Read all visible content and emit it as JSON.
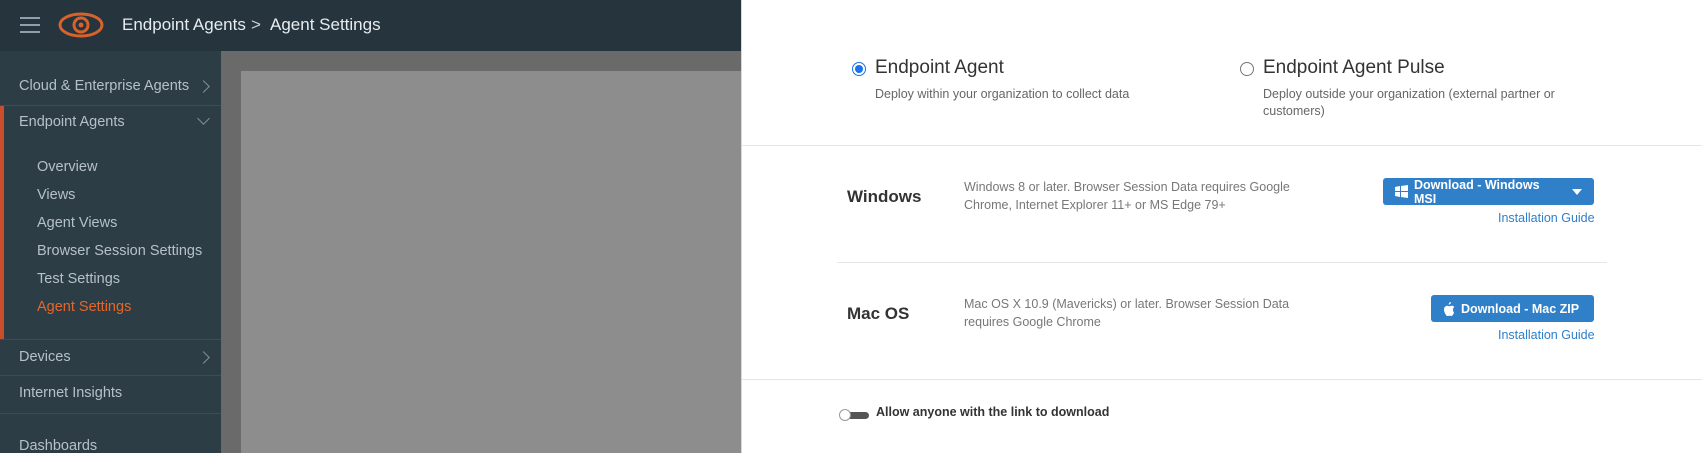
{
  "header": {
    "breadcrumb_1": "Endpoint Agents",
    "separator": ">",
    "breadcrumb_2": "Agent Settings"
  },
  "sidebar": {
    "items": [
      {
        "label": "Cloud & Enterprise Agents"
      },
      {
        "label": "Endpoint Agents"
      },
      {
        "label": "Devices"
      },
      {
        "label": "Internet Insights"
      },
      {
        "label": "Dashboards"
      }
    ],
    "subitems": [
      {
        "label": "Overview"
      },
      {
        "label": "Views"
      },
      {
        "label": "Agent Views"
      },
      {
        "label": "Browser Session Settings"
      },
      {
        "label": "Test Settings"
      },
      {
        "label": "Agent Settings"
      }
    ],
    "active_color": "#e3672b"
  },
  "drawer": {
    "options": [
      {
        "title": "Endpoint Agent",
        "desc": "Deploy within your organization to collect data",
        "selected": true
      },
      {
        "title": "Endpoint Agent Pulse",
        "desc": "Deploy outside your organization (external partner or customers)",
        "selected": false
      }
    ],
    "platforms": [
      {
        "name": "Windows",
        "desc": "Windows 8 or later. Browser Session Data requires Google Chrome, Internet Explorer 11+ or MS Edge 79+",
        "button": "Download - Windows MSI",
        "guide": "Installation Guide",
        "icon": "windows-icon"
      },
      {
        "name": "Mac OS",
        "desc": "Mac OS X 10.9 (Mavericks) or later. Browser Session Data requires Google Chrome",
        "button": "Download - Mac ZIP",
        "guide": "Installation Guide",
        "icon": "apple-icon"
      }
    ],
    "toggle_label": "Allow anyone with the link to download",
    "toggle_on": false,
    "accent": "#2f7fc9"
  }
}
